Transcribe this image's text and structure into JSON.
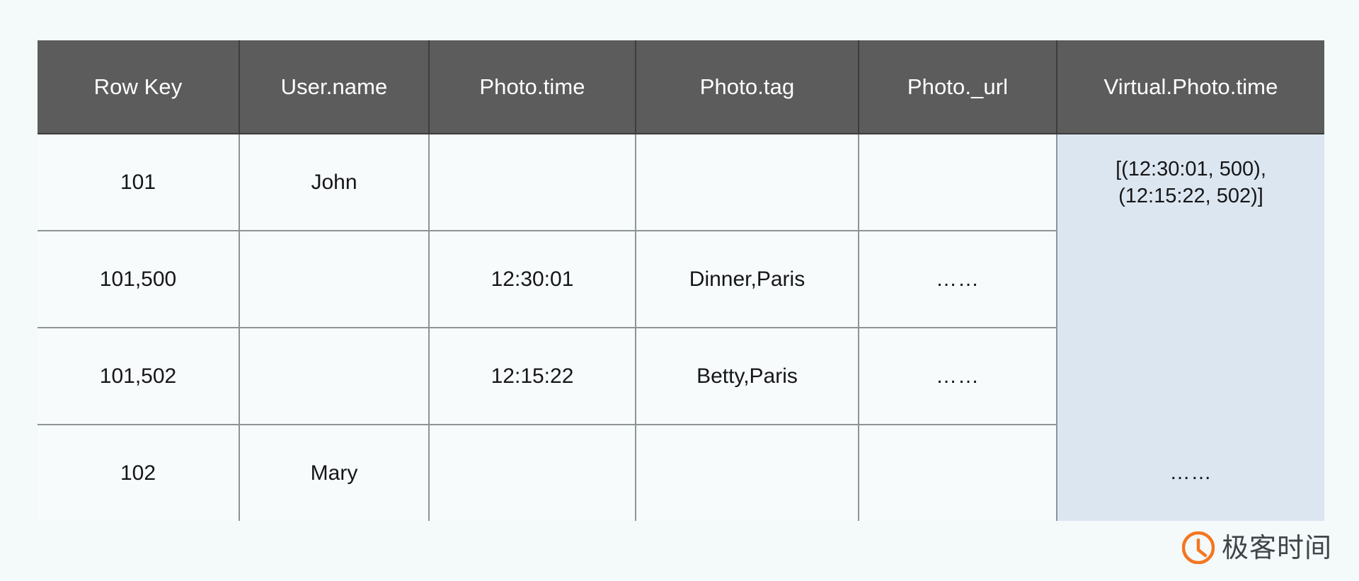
{
  "table": {
    "columns": [
      {
        "key": "row_key",
        "label": "Row Key"
      },
      {
        "key": "user_name",
        "label": "User.name"
      },
      {
        "key": "photo_time",
        "label": "Photo.time"
      },
      {
        "key": "photo_tag",
        "label": "Photo.tag"
      },
      {
        "key": "photo_url",
        "label": "Photo._url"
      },
      {
        "key": "virtual_photo_time",
        "label": "Virtual.Photo.time"
      }
    ],
    "rows": [
      {
        "row_key": "101",
        "user_name": "John",
        "photo_time": "",
        "photo_tag": "",
        "photo_url": "",
        "virtual_line_1": "[(12:30:01, 500),",
        "virtual_line_2": "(12:15:22, 502)]"
      },
      {
        "row_key": "101,500",
        "user_name": "",
        "photo_time": "12:30:01",
        "photo_tag": "Dinner,Paris",
        "photo_url": "……",
        "virtual_line_1": "",
        "virtual_line_2": ""
      },
      {
        "row_key": "101,502",
        "user_name": "",
        "photo_time": "12:15:22",
        "photo_tag": "Betty,Paris",
        "photo_url": "……",
        "virtual_line_1": "",
        "virtual_line_2": ""
      },
      {
        "row_key": "102",
        "user_name": "Mary",
        "photo_time": "",
        "photo_tag": "",
        "photo_url": "",
        "virtual_line_1": "……",
        "virtual_line_2": ""
      }
    ]
  },
  "watermark": {
    "text": "极客时间",
    "icon": "geek-time-logo-icon"
  },
  "colors": {
    "header_bg": "#5c5c5c",
    "header_text": "#ffffff",
    "body_bg": "#f7fbfc",
    "page_bg": "#f4f9fa",
    "virtual_cell_bg": "#dce6f1",
    "grid_line": "#8d9496",
    "header_grid_line": "#3d3d3d",
    "watermark_accent": "#f4761f",
    "watermark_text": "#3f4548"
  }
}
